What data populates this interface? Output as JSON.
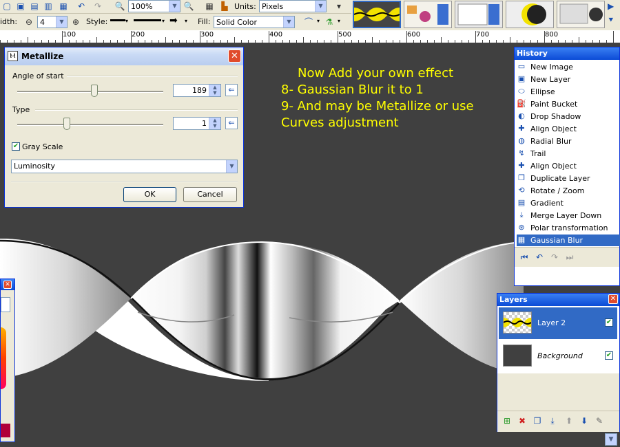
{
  "toolbar": {
    "zoom_value": "100%",
    "units_label": "Units:",
    "units_value": "Pixels",
    "width_label": "idth:",
    "width_value": "4",
    "style_label": "Style:",
    "fill_label": "Fill:",
    "fill_value": "Solid Color"
  },
  "ruler": {
    "ticks": [
      "100",
      "200",
      "300",
      "400",
      "500",
      "600",
      "700",
      "800"
    ]
  },
  "instructions": {
    "line1": "Now Add your own effect",
    "line2": "8- Gaussian Blur it to 1",
    "line3": "9- And may be Metallize or use",
    "line4": "Curves adjustment"
  },
  "dialog": {
    "title": "Metallize",
    "angle_label": "Angle of start",
    "angle_value": "189",
    "angle_fraction": 0.53,
    "type_label": "Type",
    "type_value": "1",
    "type_fraction": 0.34,
    "grayscale_label": "Gray Scale",
    "grayscale_checked": true,
    "mode_value": "Luminosity",
    "ok_label": "OK",
    "cancel_label": "Cancel"
  },
  "history": {
    "title": "History",
    "items": [
      {
        "label": "New Image",
        "icon": "new-image-icon"
      },
      {
        "label": "New Layer",
        "icon": "new-layer-icon"
      },
      {
        "label": "Ellipse",
        "icon": "ellipse-icon"
      },
      {
        "label": "Paint Bucket",
        "icon": "paint-bucket-icon"
      },
      {
        "label": "Drop Shadow",
        "icon": "drop-shadow-icon"
      },
      {
        "label": "Align Object",
        "icon": "align-object-icon"
      },
      {
        "label": "Radial Blur",
        "icon": "radial-blur-icon"
      },
      {
        "label": "Trail",
        "icon": "trail-icon"
      },
      {
        "label": "Align Object",
        "icon": "align-object-icon"
      },
      {
        "label": "Duplicate Layer",
        "icon": "duplicate-layer-icon"
      },
      {
        "label": "Rotate / Zoom",
        "icon": "rotate-zoom-icon"
      },
      {
        "label": "Gradient",
        "icon": "gradient-icon"
      },
      {
        "label": "Merge Layer Down",
        "icon": "merge-layer-down-icon"
      },
      {
        "label": "Polar transformation",
        "icon": "polar-transformation-icon"
      },
      {
        "label": "Gaussian Blur",
        "icon": "gaussian-blur-icon"
      }
    ]
  },
  "layers": {
    "title": "Layers",
    "items": [
      {
        "label": "Layer 2",
        "visible": true
      },
      {
        "label": "Background",
        "visible": true
      }
    ]
  }
}
